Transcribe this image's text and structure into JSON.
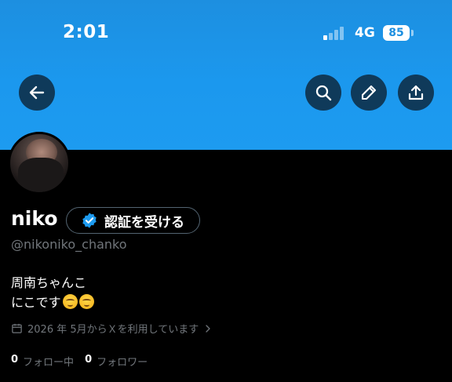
{
  "status_bar": {
    "time": "2:01",
    "network": "4G",
    "battery": "85"
  },
  "header": {
    "back_icon": "arrow-left-icon",
    "search_icon": "search-icon",
    "edit_icon": "pencil-icon",
    "share_icon": "upload-icon",
    "banner_color": "#1d9bf0"
  },
  "profile": {
    "display_name": "niko",
    "verify_label": "認証を受ける",
    "verify_icon": "verified-badge-icon",
    "handle": "@nikoniko_chanko",
    "bio_line1": "周南ちゃんこ",
    "bio_line2": "にこです",
    "bio_emoji": [
      "relieved-face-emoji",
      "relieved-face-emoji"
    ],
    "joined": "2026 年 5月からＸを利用しています",
    "joined_icon": "calendar-icon",
    "following_count": "0",
    "following_label": "フォロー中",
    "followers_count": "0",
    "followers_label": "フォロワー"
  }
}
